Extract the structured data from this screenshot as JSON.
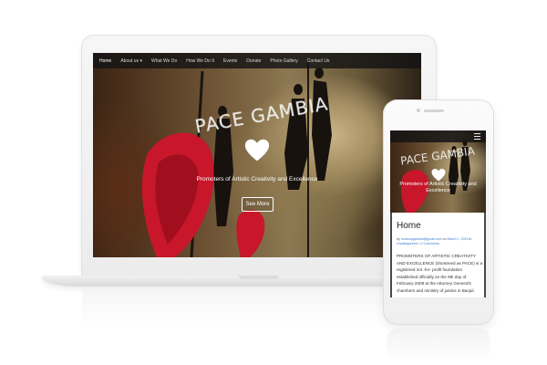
{
  "site": {
    "title": "PACE GAMBIA",
    "tagline": "Promoters of Artistic Creativity and Excellence",
    "cta_label": "See More",
    "heart_icon": "heart-icon"
  },
  "laptop_nav": {
    "items": [
      {
        "label": "Home",
        "active": true
      },
      {
        "label": "About us ▾"
      },
      {
        "label": "What We Do"
      },
      {
        "label": "How We Do It"
      },
      {
        "label": "Events"
      },
      {
        "label": "Donate"
      },
      {
        "label": "Photo Gallery"
      },
      {
        "label": "Contact Us"
      }
    ]
  },
  "phone": {
    "menu_icon": "hamburger-menu-icon",
    "page_heading": "Home",
    "meta": {
      "by": "by",
      "email": "modoupgambia@gmail.com",
      "on": "on",
      "date": "March 1, 2015",
      "in": "in",
      "category": "Uncategorized",
      "comments": "2 Comments"
    },
    "body_text": "PROMOTERS OF ARTISTIC CREATIVITY AND EXCELLENCE (shortened as PACE) is a registered not -for- profit foundation established officially on the 9th day of February-2009 at the Attorney General's chambers and ministry of justice in Banjul."
  },
  "colors": {
    "accent_red": "#d4182a",
    "nav_bg": "#141414",
    "link_blue": "#3a7bd5"
  }
}
